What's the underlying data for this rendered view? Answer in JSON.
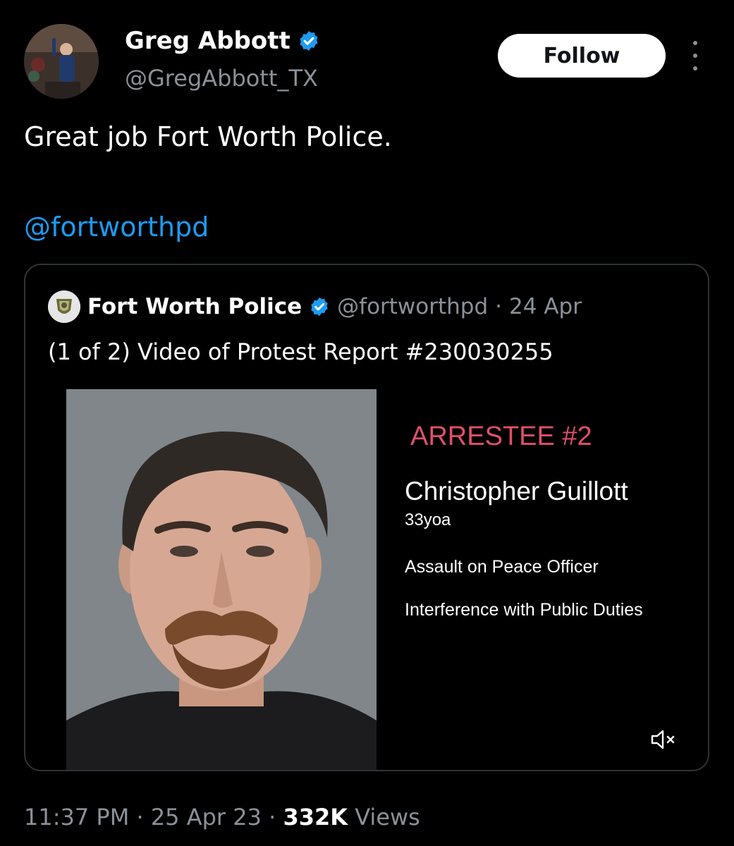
{
  "author": {
    "name": "Greg Abbott",
    "handle": "@GregAbbott_TX"
  },
  "actions": {
    "follow_label": "Follow"
  },
  "tweet": {
    "text": "Great job Fort Worth Police.",
    "mention": "@fortworthpd"
  },
  "quote": {
    "name": "Fort Worth Police",
    "handle": "@fortworthpd",
    "separator": "·",
    "date": "24 Apr",
    "text": "(1 of 2) Video of Protest Report #230030255",
    "media": {
      "label": "ARRESTEE #2",
      "name": "Christopher Guillott",
      "age": "33yoa",
      "charges": [
        "Assault on Peace Officer",
        "Interference with Public Duties"
      ]
    }
  },
  "meta": {
    "time": "11:37 PM",
    "sep1": "·",
    "date": "25 Apr 23",
    "sep2": "·",
    "views_count": "332K",
    "views_label": "Views"
  },
  "colors": {
    "background": "#000000",
    "link_blue": "#1d9bf0",
    "verified_blue": "#1d9bf0",
    "muted_text": "#8b9198",
    "arrestee_red": "#e0506a"
  },
  "icons": {
    "verified": "verified-badge-icon",
    "more": "more-options-icon",
    "mute": "mute-icon"
  }
}
